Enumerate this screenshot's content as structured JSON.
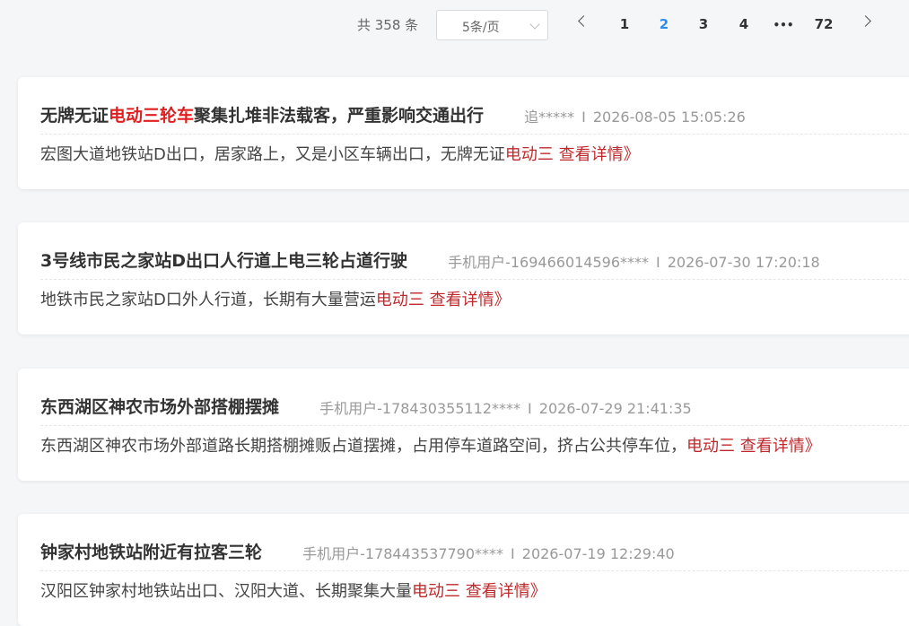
{
  "pagination": {
    "total_text": "共 358 条",
    "page_size_label": "5条/页",
    "pages": [
      "1",
      "2",
      "3",
      "4",
      "•••",
      "72"
    ],
    "active_page": "2"
  },
  "records": [
    {
      "title_pre": "无牌无证",
      "title_highlight": "电动三轮车",
      "title_post": "聚集扎堆非法载客，严重影响交通出行",
      "author": "追*****",
      "separator": "I",
      "time": "2026-08-05 15:05:26",
      "summary": "宏图大道地铁站D出口，居家路上，又是小区车辆出口，无牌无证",
      "summary_highlight": "电动三",
      "more_label": "查看详情》"
    },
    {
      "title_pre": "3号线市民之家站D出口人行道上电三轮占道行驶",
      "title_highlight": "",
      "title_post": "",
      "author": "手机用户-169466014596****",
      "separator": "I",
      "time": "2026-07-30 17:20:18",
      "summary": "地铁市民之家站D口外人行道，长期有大量营运",
      "summary_highlight": "电动三",
      "more_label": "查看详情》"
    },
    {
      "title_pre": "东西湖区神农市场外部搭棚摆摊",
      "title_highlight": "",
      "title_post": "",
      "author": "手机用户-178430355112****",
      "separator": "I",
      "time": "2026-07-29 21:41:35",
      "summary": "东西湖区神农市场外部道路长期搭棚摊贩占道摆摊，占用停车道路空间，挤占公共停车位，",
      "summary_highlight": "电动三",
      "more_label": "查看详情》"
    },
    {
      "title_pre": "钟家村地铁站附近有拉客三轮",
      "title_highlight": "",
      "title_post": "",
      "author": "手机用户-178443537790****",
      "separator": "I",
      "time": "2026-07-19 12:29:40",
      "summary": "汉阳区钟家村地铁站出口、汉阳大道、长期聚集大量",
      "summary_highlight": "电动三",
      "more_label": "查看详情》"
    }
  ],
  "colors": {
    "highlight": "#e02020",
    "more_link": "#c0292b",
    "active_page": "#2d8cf0"
  }
}
